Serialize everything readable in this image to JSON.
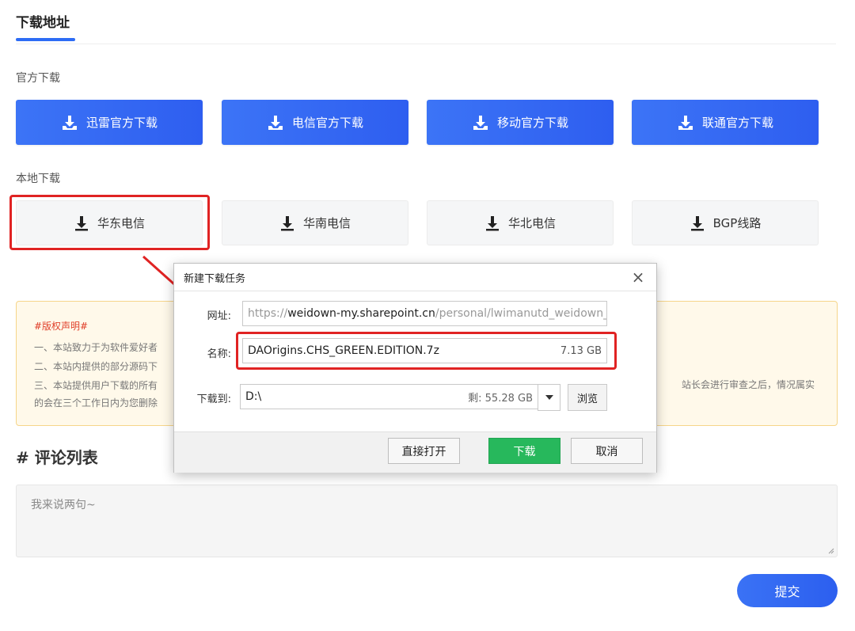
{
  "page": {
    "tab_title": "下载地址"
  },
  "official": {
    "label": "官方下载",
    "buttons": [
      "迅雷官方下载",
      "电信官方下载",
      "移动官方下载",
      "联通官方下载"
    ]
  },
  "local": {
    "label": "本地下载",
    "buttons": [
      "华东电信",
      "华南电信",
      "华北电信",
      "BGP线路"
    ]
  },
  "notice": {
    "title": "#版权声明#",
    "line1": "一、本站致力于为软件爱好者",
    "line2": "二、本站内提供的部分源码下",
    "line3": "三、本站提供用户下载的所有",
    "line3_right": "站长会进行审查之后，情况属实",
    "line4": "的会在三个工作日内为您删除"
  },
  "comments": {
    "heading": "# 评论列表",
    "placeholder": "我来说两句~",
    "submit": "提交"
  },
  "dialog": {
    "title": "新建下载任务",
    "close": "×",
    "url_label": "网址:",
    "url_scheme": "https://",
    "url_domain": "weidown-my.sharepoint.cn",
    "url_path": "/personal/lwimanutd_weidown_pa",
    "name_label": "名称:",
    "file_name": "DAOrigins.CHS_GREEN.EDITION.7z",
    "file_size": "7.13 GB",
    "path_label": "下载到:",
    "path_value": "D:\\",
    "free_space": "剩: 55.28 GB",
    "browse": "浏览",
    "open_directly": "直接打开",
    "download": "下载",
    "cancel": "取消"
  },
  "colors": {
    "primary_blue": "#2e5ef0",
    "highlight_red": "#e02323",
    "download_green": "#27b85c"
  }
}
